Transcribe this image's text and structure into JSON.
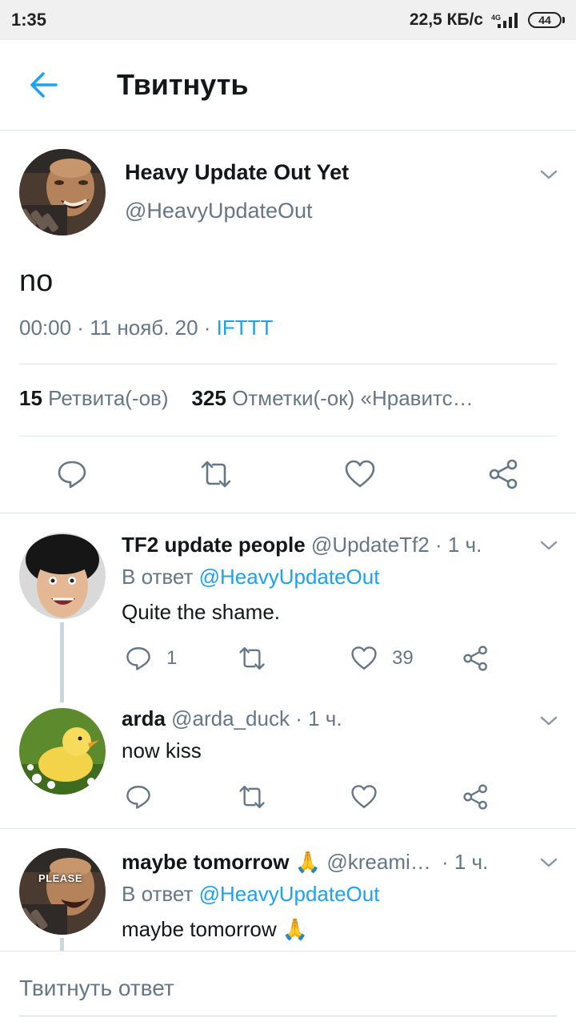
{
  "status_bar": {
    "time": "1:35",
    "speed": "22,5 КБ/с",
    "network": "4G",
    "battery": "44"
  },
  "header": {
    "title": "Твитнуть"
  },
  "main_tweet": {
    "name": "Heavy Update Out Yet",
    "handle": "@HeavyUpdateOut",
    "text": "no",
    "time": "00:00",
    "date": "11 нояб. 20",
    "source": "IFTTT",
    "retweets_count": "15",
    "retweets_label": "Ретвита(-ов)",
    "likes_count": "325",
    "likes_label": "Отметки(-ок) «Нравитс…"
  },
  "replies": [
    {
      "name": "TF2 update people",
      "handle": "@UpdateTf2",
      "time": "· 1 ч.",
      "reply_prefix": "В ответ",
      "reply_to": "@HeavyUpdateOut",
      "text": "Quite the shame.",
      "reply_count": "1",
      "like_count": "39"
    },
    {
      "name": "arda",
      "handle": "@arda_duck",
      "time": "· 1 ч.",
      "text": "now kiss"
    },
    {
      "name": "maybe tomorrow",
      "emoji": "🙏",
      "handle": "@kreami…",
      "time": "· 1 ч.",
      "reply_prefix": "В ответ",
      "reply_to": "@HeavyUpdateOut",
      "text": "maybe tomorrow",
      "avatar_text": "PLEASE"
    }
  ],
  "reply_box": {
    "placeholder": "Твитнуть ответ"
  },
  "colors": {
    "accent": "#1da1f2",
    "secondary_text": "#657786",
    "divider": "#e1e8ed"
  }
}
